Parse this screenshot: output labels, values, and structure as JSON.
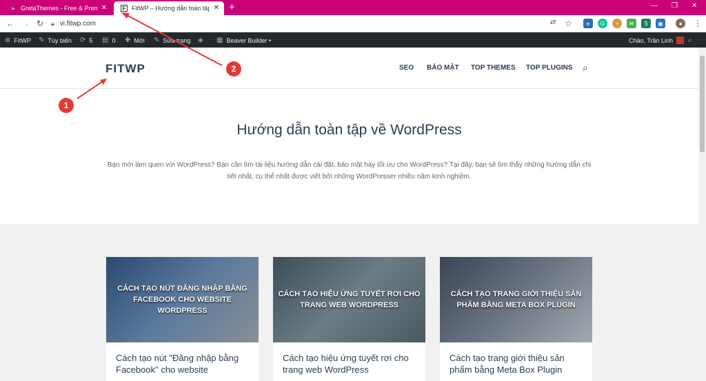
{
  "browser": {
    "tabs": [
      {
        "title": "GretaThemes - Free & Premium",
        "active": false
      },
      {
        "title": "FitWP – Hướng dẫn toàn tập về W",
        "active": true
      }
    ],
    "new_tab": "+",
    "url": "vi.fitwp.com",
    "accent": "#cc0077"
  },
  "wp_admin_bar": {
    "site": "FitWP",
    "customize": "Tùy biến",
    "updates": "5",
    "comments": "0",
    "new": "Mới",
    "edit": "Sửa trang",
    "beaver": "Beaver Builder •",
    "greeting": "Chào, Trần Linh"
  },
  "site": {
    "logo": "FITWP",
    "menu": [
      "SEO",
      "BẢO MẬT",
      "TOP THEMES",
      "TOP PLUGINS"
    ]
  },
  "hero": {
    "title": "Hướng dẫn toàn tập về WordPress",
    "description": "Bạn mới làm quen với WordPress? Bạn cần tìm tài liệu hướng dẫn cài đặt, bảo mật hay tối ưu cho WordPress? Tại đây, bạn sẽ tìm thấy những hướng dẫn chi tiết nhất, cụ thể nhất được viết bởi những WordPresser nhiều năm kinh nghiệm."
  },
  "posts": [
    {
      "thumb_text": "CÁCH TẠO NÚT ĐĂNG NHẬP BẰNG FACEBOOK CHO WEBSITE WORDPRESS",
      "title": "Cách tạo nút \"Đăng nhập bằng Facebook\" cho website",
      "color": "#3b5578"
    },
    {
      "thumb_text": "CÁCH TẠO HIỆU ỨNG TUYẾT RƠI CHO TRANG WEB WORDPRESS",
      "title": "Cách tạo hiệu ứng tuyết rơi cho trang web WordPress",
      "color": "#4a5e6a"
    },
    {
      "thumb_text": "CÁCH TẠO TRANG GIỚI THIỆU SẢN PHẨM BẰNG META BOX PLUGIN",
      "title": "Cách tạo trang giới thiệu sản phẩm bằng Meta Box Plugin",
      "color": "#3f4a5a"
    }
  ],
  "annotations": [
    "1",
    "2"
  ]
}
